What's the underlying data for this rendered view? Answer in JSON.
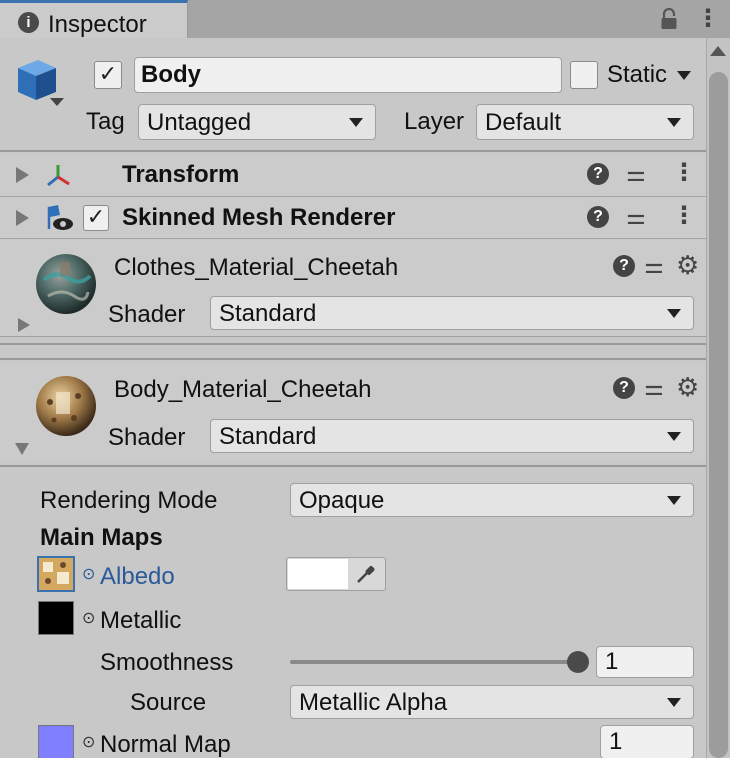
{
  "window": {
    "tab_title": "Inspector"
  },
  "object": {
    "active": true,
    "name": "Body",
    "static_label": "Static",
    "static_checked": false,
    "tag_label": "Tag",
    "tag_value": "Untagged",
    "layer_label": "Layer",
    "layer_value": "Default"
  },
  "components": [
    {
      "name": "Transform",
      "icon": "transform-icon"
    },
    {
      "name": "Skinned Mesh Renderer",
      "icon": "skinned-mesh-renderer-icon",
      "enabled": true
    }
  ],
  "materials": [
    {
      "name": "Clothes_Material_Cheetah",
      "shader_label": "Shader",
      "shader_value": "Standard",
      "expanded": false
    },
    {
      "name": "Body_Material_Cheetah",
      "shader_label": "Shader",
      "shader_value": "Standard",
      "expanded": true
    }
  ],
  "properties": {
    "rendering_mode_label": "Rendering Mode",
    "rendering_mode_value": "Opaque",
    "main_maps_label": "Main Maps",
    "albedo_label": "Albedo",
    "albedo_color": "#ffffff",
    "metallic_label": "Metallic",
    "metallic_color": "#000000",
    "smoothness_label": "Smoothness",
    "smoothness_value": "1",
    "smoothness_level": 1.0,
    "source_label": "Source",
    "source_value": "Metallic Alpha",
    "normal_map_label": "Normal Map",
    "normal_map_value": "1",
    "normal_map_color": "#7f7fff"
  },
  "colors": {
    "accent": "#3a72b0",
    "link": "#2a5a9a"
  }
}
